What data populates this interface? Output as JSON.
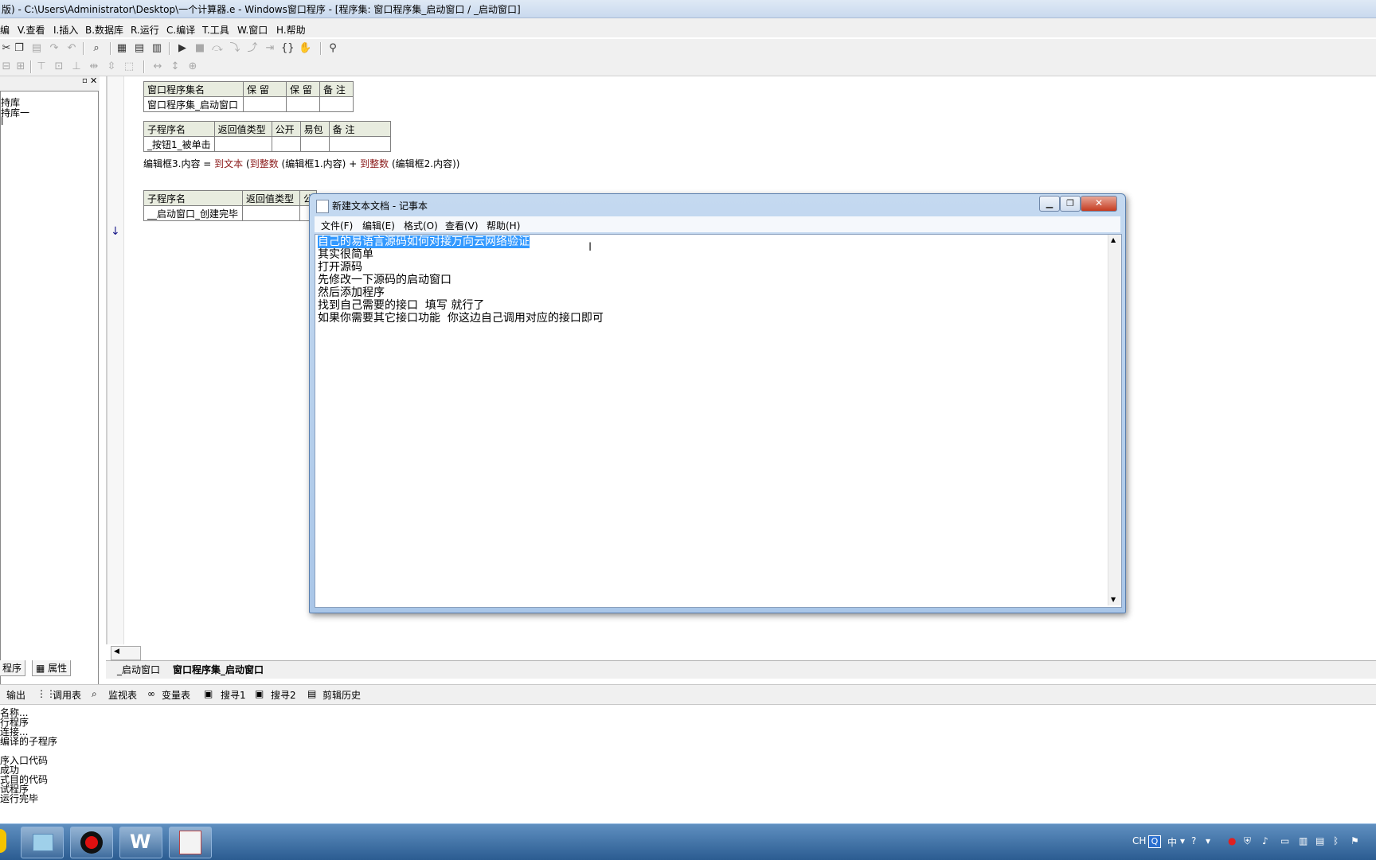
{
  "ide": {
    "title": "版) - C:\\Users\\Administrator\\Desktop\\一个计算器.e - Windows窗口程序 - [程序集: 窗口程序集_启动窗口 / _启动窗口]",
    "menu": [
      "编",
      "V.查看",
      "I.插入",
      "B.数据库",
      "R.运行",
      "C.编译",
      "T.工具",
      "W.窗口",
      "H.帮助"
    ]
  },
  "left_panel": {
    "tree_items": [
      "持库",
      "持库一",
      "l"
    ],
    "tabs": [
      "程序",
      "属性"
    ]
  },
  "editor": {
    "assembly_table": {
      "headers": [
        "窗口程序集名",
        "保 留",
        "保 留",
        "备 注"
      ],
      "row": [
        "窗口程序集_启动窗口",
        "",
        "",
        ""
      ]
    },
    "sub1_table": {
      "headers": [
        "子程序名",
        "返回值类型",
        "公开",
        "易包",
        "备 注"
      ],
      "row": [
        "_按钮1_被单击",
        "",
        "",
        "",
        ""
      ]
    },
    "code_line": {
      "target": "编辑框3.内容",
      "op": "=",
      "fn1": "到文本",
      "open1": "(",
      "fn2": "到整数",
      "arg1": "(编辑框1.内容)",
      "plus": "+",
      "fn3": "到整数",
      "arg2": "(编辑框2.内容))"
    },
    "sub2_table": {
      "headers": [
        "子程序名",
        "返回值类型",
        "公"
      ],
      "row": [
        "__启动窗口_创建完毕",
        "",
        ""
      ]
    },
    "doc_tabs": [
      "_启动窗口",
      "窗口程序集_启动窗口"
    ]
  },
  "output": {
    "tabs": [
      "输出",
      "调用表",
      "监视表",
      "变量表",
      "搜寻1",
      "搜寻2",
      "剪辑历史"
    ],
    "lines": [
      "名称...",
      "行程序",
      "连接...",
      "编译的子程序",
      "",
      "序入口代码",
      "成功",
      "式目的代码",
      "试程序",
      "运行完毕"
    ]
  },
  "taskbar": {
    "tray_lang": "CH",
    "tray_ime": "中"
  },
  "notepad": {
    "title": "新建文本文档 - 记事本",
    "menu": [
      "文件(F)",
      "编辑(E)",
      "格式(O)",
      "查看(V)",
      "帮助(H)"
    ],
    "lines": [
      "自己的易语言源码如何对接万向云网络验证",
      "其实很简单",
      "打开源码",
      "先修改一下源码的启动窗口",
      "然后添加程序",
      "找到自己需要的接口  填写 就行了",
      "如果你需要其它接口功能  你这边自己调用对应的接口即可"
    ],
    "selected_line_index": 0
  }
}
